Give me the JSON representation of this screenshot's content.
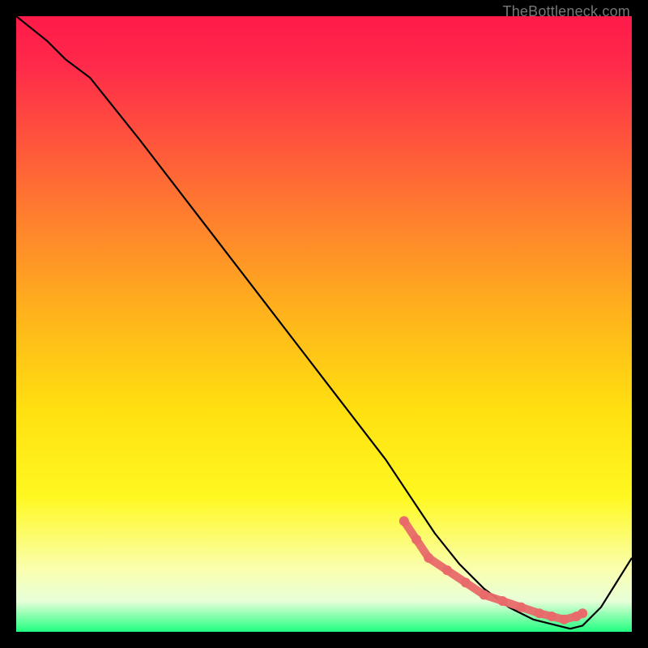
{
  "watermark": "TheBottleneck.com",
  "chart_data": {
    "type": "line",
    "title": "",
    "xlabel": "",
    "ylabel": "",
    "xlim": [
      0,
      100
    ],
    "ylim": [
      0,
      100
    ],
    "grid": false,
    "series": [
      {
        "name": "curve",
        "color": "#000000",
        "x": [
          0,
          5,
          8,
          12,
          20,
          30,
          40,
          50,
          60,
          64,
          68,
          72,
          76,
          80,
          84,
          88,
          90,
          92,
          95,
          100
        ],
        "y": [
          100,
          96,
          93,
          90,
          80,
          67,
          54,
          41,
          28,
          22,
          16,
          11,
          7,
          4,
          2,
          1,
          0.5,
          1,
          4,
          12
        ]
      }
    ],
    "markers": [
      {
        "name": "bottom-dots",
        "color": "#e86a6a",
        "x": [
          63,
          65,
          67,
          70,
          73,
          76,
          79,
          82,
          85,
          87,
          89,
          91,
          92
        ],
        "y": [
          18,
          15,
          12,
          10,
          8,
          6,
          5,
          4,
          3,
          2.5,
          2,
          2.5,
          3
        ]
      }
    ]
  }
}
